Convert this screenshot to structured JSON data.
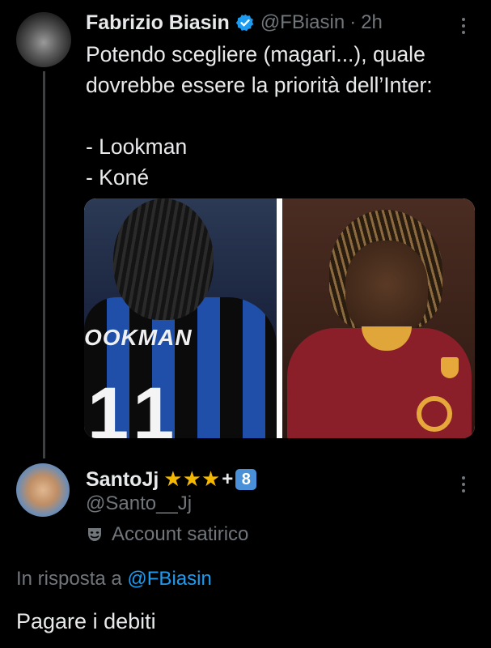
{
  "tweet": {
    "author_name": "Fabrizio Biasin",
    "handle": "@FBiasin",
    "time": "2h",
    "separator": "·",
    "verified": true,
    "text_lines": [
      "Potendo scegliere (magari...), quale",
      "dovrebbe essere la priorità dell’Inter:",
      "",
      "- Lookman",
      "- Koné"
    ],
    "media": {
      "left_photo_jersey_text": "OOKMAN",
      "left_photo_number": "11",
      "icons": {
        "left": "player-photo-lookman",
        "right": "player-photo-kone"
      }
    }
  },
  "reply": {
    "author_name": "SantoJj",
    "stars": "★★★",
    "plus": "+",
    "badge_number": "8",
    "handle": "@Santo__Jj",
    "label": "Account satirico",
    "in_reply_prefix": "In risposta a",
    "in_reply_mention": "@FBiasin",
    "text": "Pagare i debiti"
  },
  "colors": {
    "background": "#000000",
    "primary_text": "#e7e9ea",
    "secondary_text": "#71767b",
    "accent": "#1d9bf0",
    "star": "#f5b800"
  }
}
